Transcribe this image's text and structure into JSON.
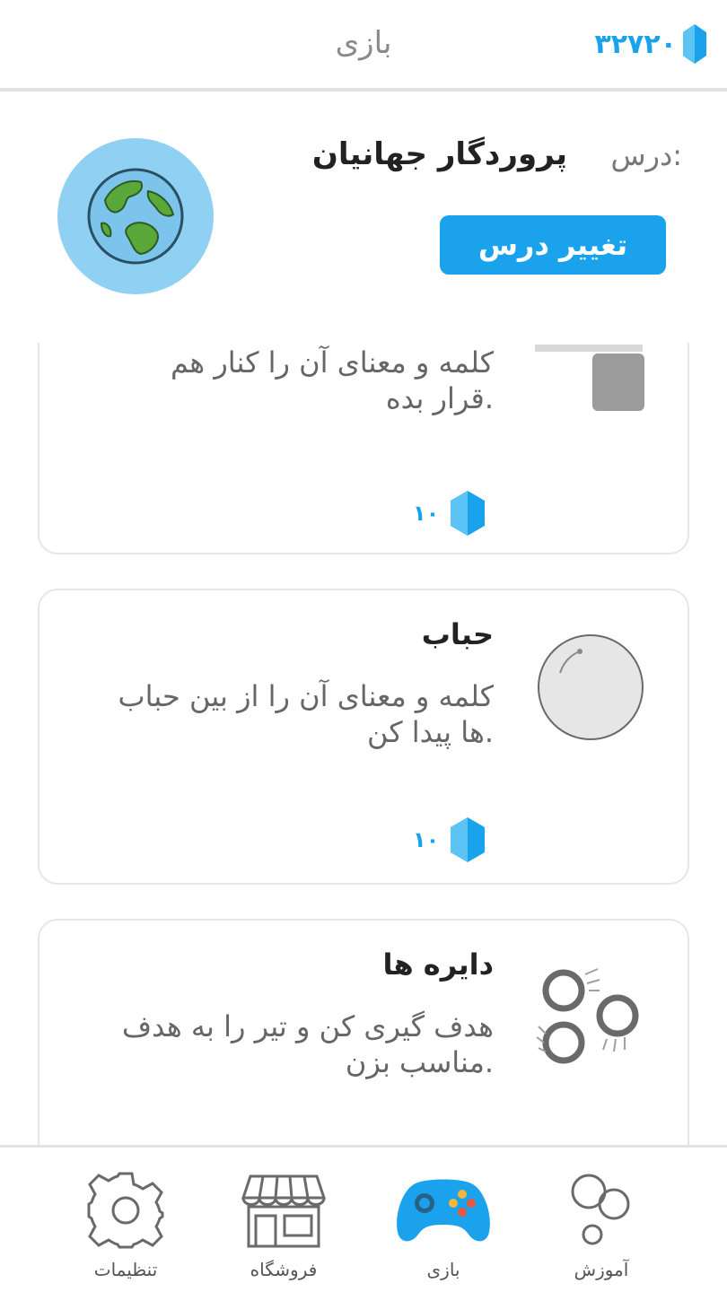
{
  "header": {
    "title": "بازی",
    "coins": "۳۲۷۲۰"
  },
  "lesson": {
    "label": "درس:",
    "name": "پروردگار جهانیان",
    "change_button": "تغییر درس"
  },
  "games": [
    {
      "title": "",
      "description": "کلمه و معنای آن را کنار هم قرار بده.",
      "reward": "۱۰",
      "icon": "matching-cards-icon"
    },
    {
      "title": "حباب",
      "description": "کلمه و معنای آن را از بین حباب ها پیدا کن.",
      "reward": "۱۰",
      "icon": "bubble-icon"
    },
    {
      "title": "دایره ها",
      "description": "هدف گیری کن و تیر را به هدف مناسب بزن.",
      "reward": "",
      "icon": "circles-icon"
    }
  ],
  "bottom_nav": [
    {
      "label": "آموزش",
      "icon": "learn-circles-icon",
      "active": false
    },
    {
      "label": "بازی",
      "icon": "gamepad-icon",
      "active": true
    },
    {
      "label": "فروشگاه",
      "icon": "store-icon",
      "active": false
    },
    {
      "label": "تنظیمات",
      "icon": "gear-icon",
      "active": false
    }
  ],
  "colors": {
    "accent": "#1aa3ec",
    "globe_bg": "#8fd0f3",
    "card_border": "#e6e6e6"
  }
}
